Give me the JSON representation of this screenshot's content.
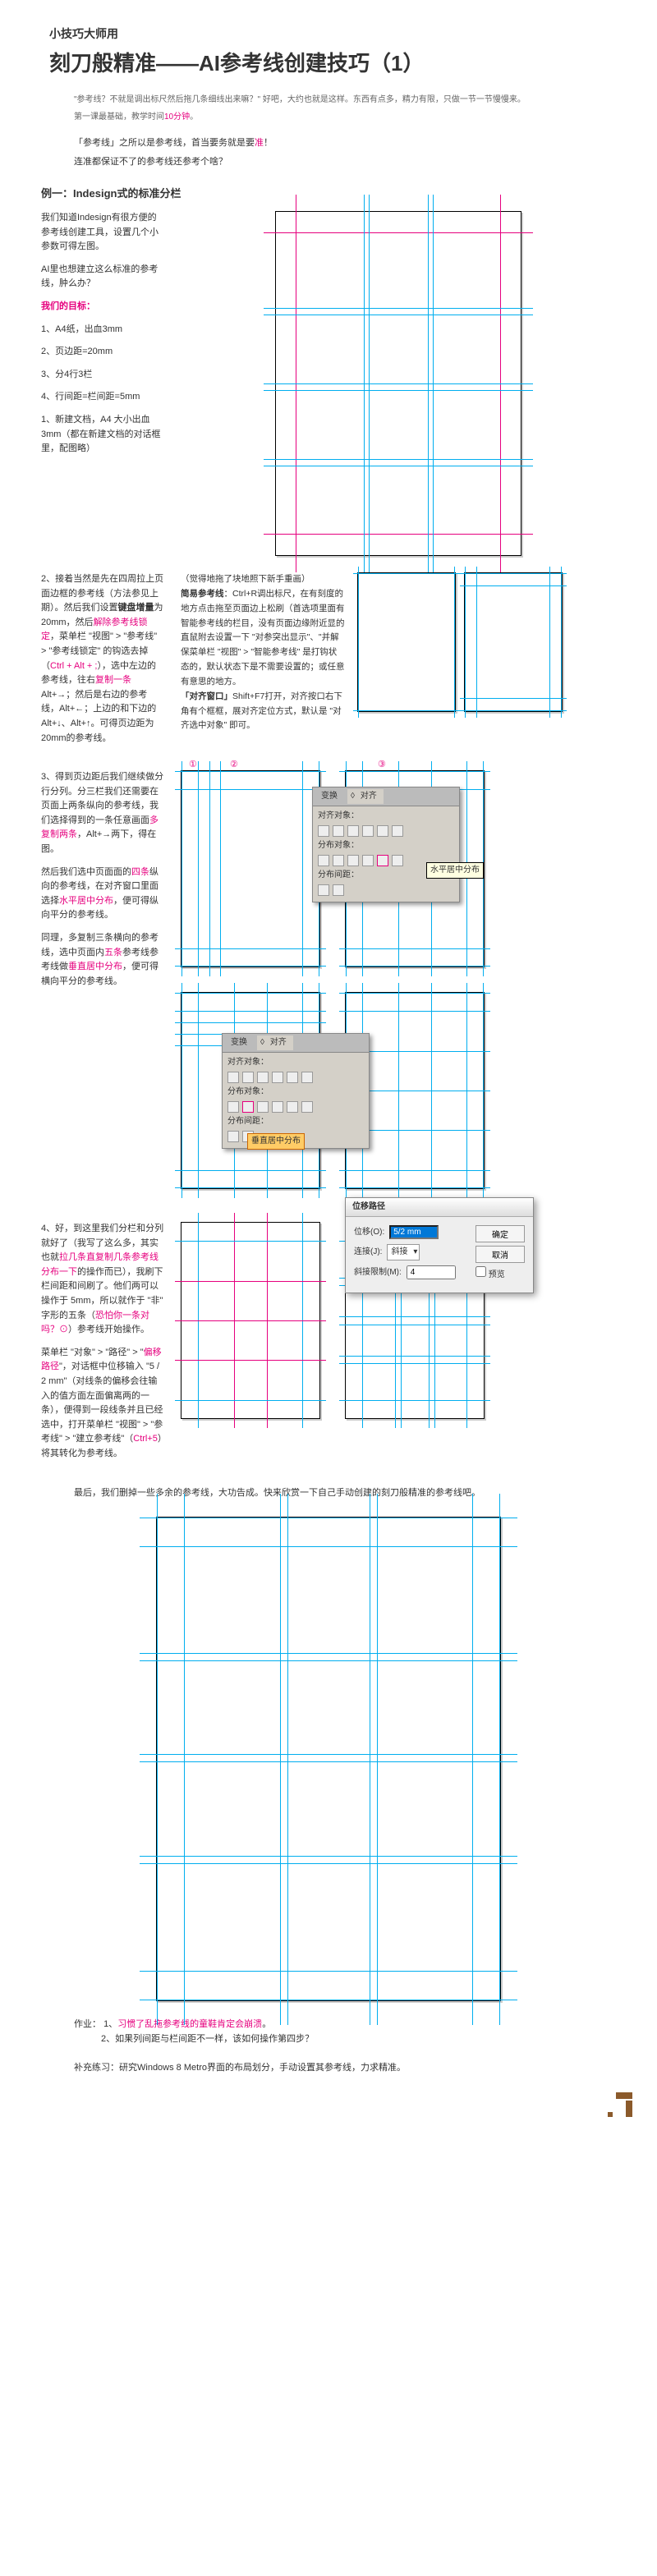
{
  "header": {
    "sup": "小技巧大师用",
    "title": "刻刀般精准——AI参考线创建技巧（1）",
    "quote_pre": "\"参考线？不就是调出标尺然后拖几条细线出来嘛？\" 好吧，大约也就是这样。东西有点多，精力有限，只做一节一节慢慢来。",
    "quote_line2_pre": "第一课最基础，教学时间",
    "quote_line2_hl": "10分钟",
    "quote_line2_post": "。",
    "intro_pre": "「参考线」之所以是参考线，首当要务就是要",
    "intro_hl": "准",
    "intro_post": "！",
    "sub": "连准都保证不了的参考线还参考个啥？"
  },
  "eg1": {
    "title": "例一：Indesign式的标准分栏",
    "p1": "我们知道Indesign有很方便的参考线创建工具，设置几个小参数可得左图。",
    "p2": "AI里也想建立这么标准的参考线，肿么办？",
    "goal_title": "我们的目标：",
    "g1": "1、A4纸，出血3mm",
    "g2": "2、页边距=20mm",
    "g3": "3、分4行3栏",
    "g4": "4、行间距=栏间距=5mm",
    "step1": "1、新建文档，A4 大小出血 3mm（都在新建文档的对话框里，配图略）"
  },
  "step2": {
    "num": "2、",
    "p1_a": "接着当然是先在四周拉上页面边框的参考线（方法参见上期）。然后我们设置",
    "p1_b": "键盘增量",
    "p1_c": "为20mm，然后",
    "p1_d": "解除参考线锁定",
    "p1_e": "，菜单栏 \"视图\" > \"参考线\" > \"参考线锁定\" 的钩选去掉（",
    "p1_f": "Ctrl + Alt + ;",
    "p1_g": "），选中左边的参考线，往右",
    "p1_h": "复制一条",
    "p1_i": "Alt+→；然后是右边的参考线，Alt+←；上边的和下边的Alt+↓、Alt+↑。可得页边距为20mm的参考线。",
    "mid_title": "（觉得地拖了块地照下新手重画）",
    "mid_b1": "简易参考线",
    "mid_t1": "：Ctrl+R调出标尺，在有刻度的地方点击拖至页面边上松刷（首选项里面有智能参考线的栏目，没有页面边缘附近显的直鼠附去设置一下 \"对参突出显示\"、\"并解保菜单栏 \"视图\" > \"智能参考线\" 是打钩状态的，默认状态下是不需要设置的；或任意有意思的地方。",
    "mid_b2": "「对齐窗口」",
    "mid_t2": "Shift+F7打开，对齐按口右下角有个框框，展对齐定位方式，默认是 \"对齐选中对象\" 即可。"
  },
  "step3": {
    "num": "3、",
    "p1_a": "得到页边距后我们继续做分行分列。分三栏我们还需要在页面上两条纵向的参考线，我们选择得到的一条任意画面",
    "p1_b": "多复制两条",
    "p1_c": "，Alt+→两下，得在图。",
    "p2_a": "然后我们选中页面面的",
    "p2_b": "四条",
    "p2_c": "纵向的参考线，在对齐窗口里面选择",
    "p2_d": "水平居中分布",
    "p2_e": "，便可得纵向平分的参考线。",
    "p3_a": "同理，多复制三条横向的参考线，选中页面内",
    "p3_b": "五条",
    "p3_c": "参考线参考线做",
    "p3_d": "垂直居中分布",
    "p3_e": "，便可得横向平分的参考线。",
    "panel_tabs": {
      "a": "变换",
      "b": "对齐"
    },
    "panel_labels": {
      "r1": "对齐对象：",
      "r2": "分布对象：",
      "r3": "分布间距："
    },
    "tooltip1": "水平居中分布",
    "tooltip2": "垂直居中分布"
  },
  "step4": {
    "num": "4、",
    "p1_a": "好，到这里我们分栏和分列就好了（我写了这么多，其实也就",
    "p1_b": "拉几条直复制几条参考线分布一下",
    "p1_c": "的操作而已），我刷下栏间距和间刷了。他们两可以操作于 5mm，所以就作于 \"非\" 字形的五条（",
    "p1_d": "恐怕你一条对吗？⊙",
    "p1_e": "）参考线开始操作。",
    "p2_a": "菜单栏 \"对象\" > \"路径\" > \"",
    "p2_b": "偏移路径",
    "p2_c": "\"，对话框中位移输入 \"5 / 2 mm\"（对线条的偏移会往输入的值方面左面偏离两的一条），便得到一段线条并且已经选中，打开菜单栏 \"视图\" > \"参考线\" > \"建立参考线\"（",
    "p2_d": "Ctrl+5",
    "p2_e": "）将其转化为参考线。",
    "dialog": {
      "title": "位移路径",
      "lbl_offset": "位移(O):",
      "val_offset": "5/2 mm",
      "lbl_join": "连接(J):",
      "val_join": "斜接",
      "lbl_limit": "斜接限制(M):",
      "val_limit": "4",
      "btn_ok": "确定",
      "btn_cancel": "取消",
      "chk_preview": "预览"
    }
  },
  "final": "最后，我们删掉一些多余的参考线，大功告成。快来欣赏一下自己手动创建的刻刀般精准的参考线吧。",
  "homework": {
    "label": "作业：",
    "h1_a": "1、",
    "h1_b": "习惯了乱拖参考线的童鞋肯定会崩溃",
    "h1_c": "。",
    "h2": "2、如果列间距与栏间距不一样，该如何操作第四步？",
    "extra": "补充练习：研究Windows 8 Metro界面的布局划分，手动设置其参考线，力求精准。"
  }
}
